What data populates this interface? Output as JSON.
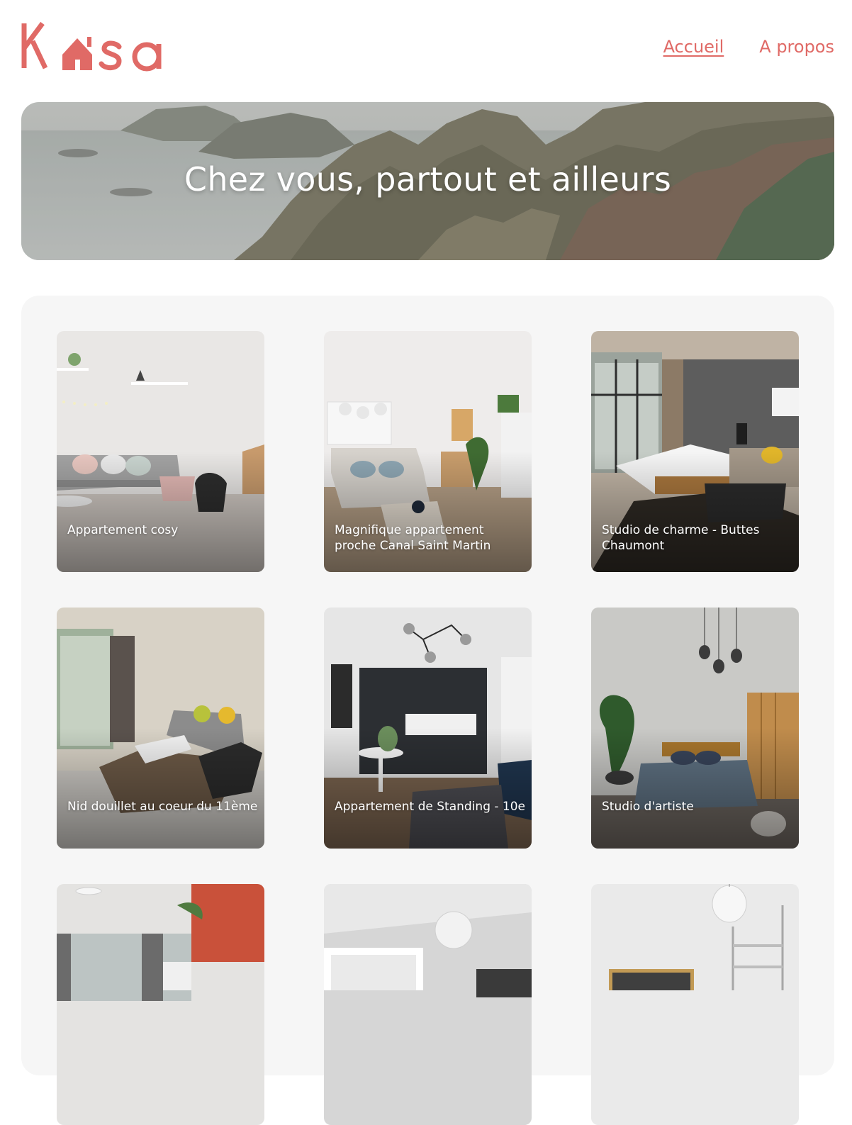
{
  "brand": {
    "name": "Kasa",
    "color": "#e06a66"
  },
  "nav": {
    "items": [
      {
        "label": "Accueil",
        "active": true
      },
      {
        "label": "A propos",
        "active": false
      }
    ]
  },
  "hero": {
    "title": "Chez vous, partout et ailleurs"
  },
  "listings": [
    {
      "title": "Appartement cosy"
    },
    {
      "title": "Magnifique appartement proche Canal Saint Martin"
    },
    {
      "title": "Studio de charme - Buttes Chaumont"
    },
    {
      "title": "Nid douillet au coeur du 11ème"
    },
    {
      "title": "Appartement de Standing - 10e"
    },
    {
      "title": "Studio d'artiste"
    },
    {
      "title": ""
    },
    {
      "title": ""
    },
    {
      "title": ""
    }
  ]
}
